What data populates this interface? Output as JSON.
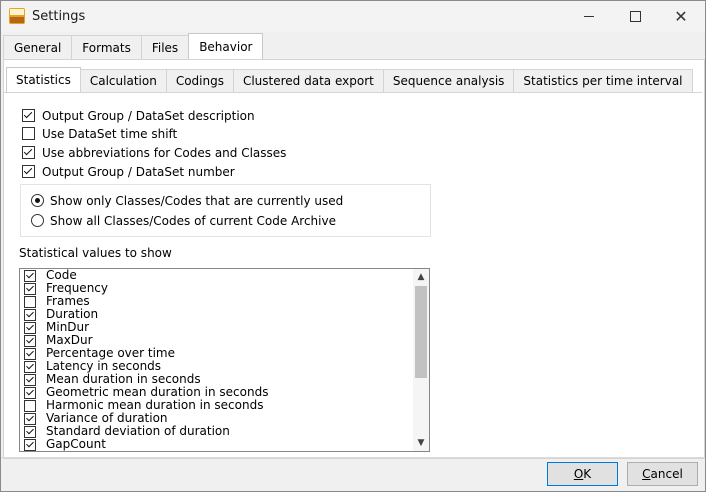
{
  "window": {
    "title": "Settings"
  },
  "tabs": [
    "General",
    "Formats",
    "Files",
    "Behavior"
  ],
  "subtabs": [
    "Statistics",
    "Calculation",
    "Codings",
    "Clustered data export",
    "Sequence analysis",
    "Statistics per time interval"
  ],
  "options": [
    {
      "label": "Output Group / DataSet description",
      "checked": true
    },
    {
      "label": "Use DataSet time shift",
      "checked": false
    },
    {
      "label": "Use abbreviations for Codes and Classes",
      "checked": true
    },
    {
      "label": "Output Group / DataSet number",
      "checked": true
    }
  ],
  "radios": [
    {
      "label": "Show only Classes/Codes that are currently used",
      "selected": true
    },
    {
      "label": "Show all Classes/Codes of current Code Archive",
      "selected": false
    }
  ],
  "stat_values_label": "Statistical values to show",
  "stat_values": [
    {
      "label": "Code",
      "checked": true
    },
    {
      "label": "Frequency",
      "checked": true
    },
    {
      "label": "Frames",
      "checked": false
    },
    {
      "label": "Duration",
      "checked": true
    },
    {
      "label": "MinDur",
      "checked": true
    },
    {
      "label": "MaxDur",
      "checked": true
    },
    {
      "label": "Percentage over time",
      "checked": true
    },
    {
      "label": "Latency in seconds",
      "checked": true
    },
    {
      "label": "Mean duration in seconds",
      "checked": true
    },
    {
      "label": "Geometric mean duration in seconds",
      "checked": true
    },
    {
      "label": "Harmonic mean duration in seconds",
      "checked": false
    },
    {
      "label": "Variance of duration",
      "checked": true
    },
    {
      "label": "Standard deviation of duration",
      "checked": true
    },
    {
      "label": "GapCount",
      "checked": true
    }
  ],
  "buttons": {
    "ok_access": "O",
    "ok_rest": "K",
    "cancel_access": "C",
    "cancel_rest": "ancel"
  },
  "icons": {
    "app": "interact-app-icon",
    "minimize": "minimize-icon",
    "maximize": "maximize-icon",
    "close": "close-icon"
  }
}
